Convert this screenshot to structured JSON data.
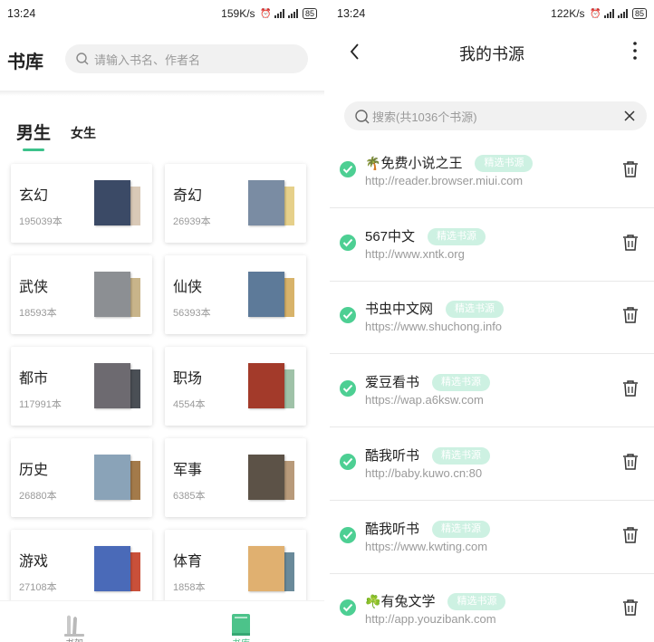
{
  "left_screen": {
    "status_bar": {
      "time": "13:24",
      "net_speed": "159K/s",
      "battery": "85"
    },
    "header": {
      "title": "书库",
      "search_placeholder": "请输入书名、作者名"
    },
    "tabs": [
      {
        "label": "男生",
        "active": true
      },
      {
        "label": "女生",
        "active": false
      }
    ],
    "categories": [
      {
        "name": "玄幻",
        "count": "195039本",
        "cover_color": "#3b4a66",
        "cover_back": "#d9c9b7"
      },
      {
        "name": "奇幻",
        "count": "26939本",
        "cover_color": "#7a8ca3",
        "cover_back": "#e6d08a"
      },
      {
        "name": "武侠",
        "count": "18593本",
        "cover_color": "#8c8f93",
        "cover_back": "#c8b48a"
      },
      {
        "name": "仙侠",
        "count": "56393本",
        "cover_color": "#5d7a99",
        "cover_back": "#d8b36a"
      },
      {
        "name": "都市",
        "count": "117991本",
        "cover_color": "#6d6a70",
        "cover_back": "#4a4f55"
      },
      {
        "name": "职场",
        "count": "4554本",
        "cover_color": "#a33a2a",
        "cover_back": "#9fc2a8"
      },
      {
        "name": "历史",
        "count": "26880本",
        "cover_color": "#8aa3b8",
        "cover_back": "#a37a4a"
      },
      {
        "name": "军事",
        "count": "6385本",
        "cover_color": "#5c5247",
        "cover_back": "#b89a7a"
      },
      {
        "name": "游戏",
        "count": "27108本",
        "cover_color": "#4a6ab8",
        "cover_back": "#c9503a"
      },
      {
        "name": "体育",
        "count": "1858本",
        "cover_color": "#e0b070",
        "cover_back": "#6a8a9a"
      }
    ],
    "bottom_nav": [
      {
        "label": "书架",
        "active": false
      },
      {
        "label": "书库",
        "active": true
      }
    ],
    "colors": {
      "accent": "#3cc28b"
    }
  },
  "right_screen": {
    "status_bar": {
      "time": "13:24",
      "net_speed": "122K/s",
      "battery": "85"
    },
    "header": {
      "title": "我的书源"
    },
    "search": {
      "placeholder": "搜索(共1036个书源)"
    },
    "sources": [
      {
        "emoji": "🌴",
        "name": "免费小说之王",
        "tag": "精选书源",
        "url": "http://reader.browser.miui.com"
      },
      {
        "emoji": "",
        "name": "567中文",
        "tag": "精选书源",
        "url": "http://www.xntk.org"
      },
      {
        "emoji": "",
        "name": "书虫中文网",
        "tag": "精选书源",
        "url": "https://www.shuchong.info"
      },
      {
        "emoji": "",
        "name": "爱豆看书",
        "tag": "精选书源",
        "url": "https://wap.a6ksw.com"
      },
      {
        "emoji": "",
        "name": "酷我听书",
        "tag": "精选书源",
        "url": "http://baby.kuwo.cn:80"
      },
      {
        "emoji": "",
        "name": "酷我听书",
        "tag": "精选书源",
        "url": "https://www.kwting.com"
      },
      {
        "emoji": "☘️",
        "name": "有兔文学",
        "tag": "精选书源",
        "url": "http://app.youzibank.com"
      }
    ],
    "colors": {
      "check": "#4dcf93",
      "tag_bg": "#cdf1e2"
    }
  }
}
